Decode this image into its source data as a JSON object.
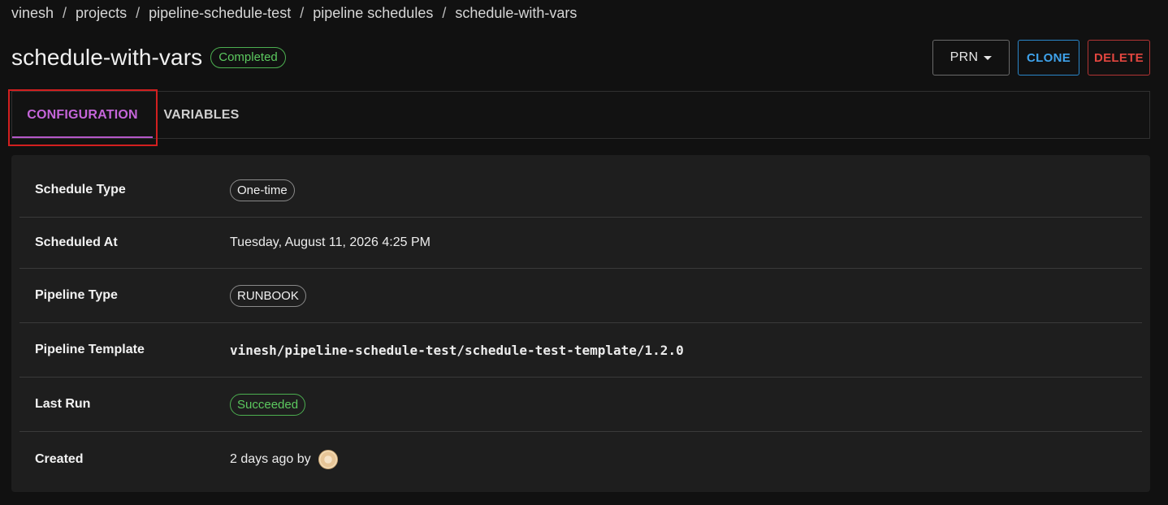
{
  "breadcrumb": [
    "vinesh",
    "projects",
    "pipeline-schedule-test",
    "pipeline schedules",
    "schedule-with-vars"
  ],
  "breadcrumb_separator": "/",
  "header": {
    "title": "schedule-with-vars",
    "status": "Completed",
    "prn_label": "PRN",
    "clone_label": "CLONE",
    "delete_label": "DELETE"
  },
  "tabs": [
    {
      "label": "CONFIGURATION",
      "active": true
    },
    {
      "label": "VARIABLES",
      "active": false
    }
  ],
  "details": {
    "schedule_type_label": "Schedule Type",
    "schedule_type_value": "One-time",
    "scheduled_at_label": "Scheduled At",
    "scheduled_at_value": "Tuesday, August 11, 2026 4:25 PM",
    "pipeline_type_label": "Pipeline Type",
    "pipeline_type_value": "RUNBOOK",
    "pipeline_template_label": "Pipeline Template",
    "pipeline_template_value": "vinesh/pipeline-schedule-test/schedule-test-template/1.2.0",
    "last_run_label": "Last Run",
    "last_run_value": "Succeeded",
    "created_label": "Created",
    "created_value": "2 days ago by"
  },
  "colors": {
    "accent": "#c565d9",
    "success": "#5cc95f",
    "clone": "#3fa3ec",
    "delete": "#e2463f"
  }
}
